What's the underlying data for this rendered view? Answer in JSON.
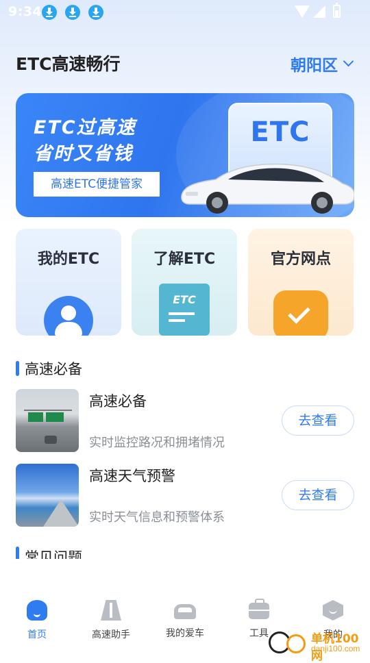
{
  "status_bar": {
    "time": "9:34"
  },
  "header": {
    "title": "ETC高速畅行",
    "district": "朝阳区"
  },
  "banner": {
    "line1": "ETC过高速",
    "line2": "省时又省钱",
    "subtitle": "高速ETC便捷管家",
    "card_text": "ETC"
  },
  "features": [
    {
      "label": "我的ETC",
      "icon": "user-icon"
    },
    {
      "label": "了解ETC",
      "icon": "etc-document-icon"
    },
    {
      "label": "官方网点",
      "icon": "check-badge-icon"
    }
  ],
  "section1": {
    "title": "高速必备",
    "items": [
      {
        "title": "高速必备",
        "desc": "实时监控路况和拥堵情况",
        "button": "去查看"
      },
      {
        "title": "高速天气预警",
        "desc": "实时天气信息和预警体系",
        "button": "去查看"
      }
    ]
  },
  "section2": {
    "title": "常见问题"
  },
  "bottom_nav": [
    {
      "label": "首页",
      "icon": "home-icon",
      "active": true
    },
    {
      "label": "高速助手",
      "icon": "road-icon",
      "active": false
    },
    {
      "label": "我的爱车",
      "icon": "car-icon",
      "active": false
    },
    {
      "label": "工具",
      "icon": "toolbox-icon",
      "active": false
    },
    {
      "label": "我的",
      "icon": "profile-icon",
      "active": false
    }
  ],
  "watermark": {
    "text": "单机100网",
    "sub": "danji100.com"
  },
  "colors": {
    "accent": "#2f7cf0",
    "banner": "#3a86f7"
  }
}
